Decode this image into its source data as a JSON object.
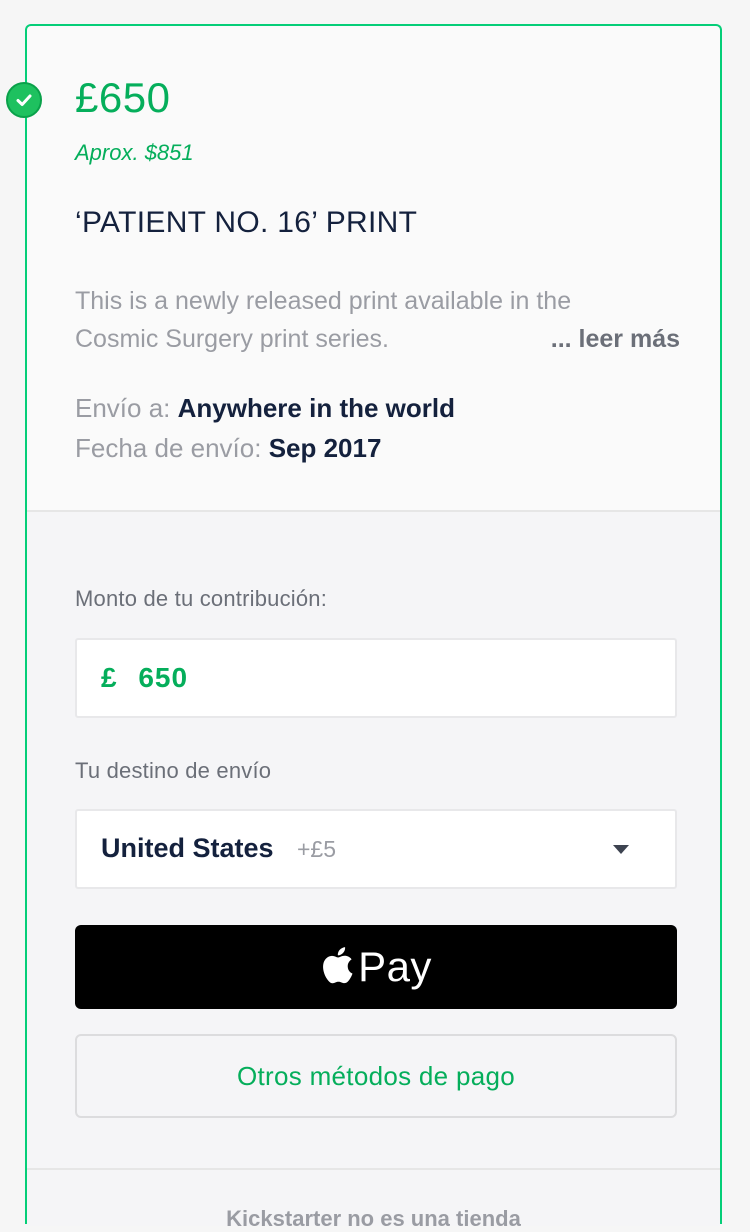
{
  "reward": {
    "price": "£650",
    "approx": "Aprox. $851",
    "title": "‘PATIENT NO. 16’ PRINT",
    "description_line1": "This is a newly released print available in the",
    "description_line2": "Cosmic Surgery print series.",
    "read_more": "... leer más",
    "ships_to_label": "Envío a: ",
    "ships_to_value": "Anywhere in the world",
    "delivery_label": "Fecha de envío: ",
    "delivery_value": "Sep 2017"
  },
  "pledge": {
    "amount_label": "Monto de tu contribución:",
    "currency_symbol": "£",
    "amount_value": "650",
    "destination_label": "Tu destino de envío",
    "destination_value": "United States",
    "destination_extra": "+£5",
    "apple_pay_label": "Pay",
    "other_methods_label": "Otros métodos de pago"
  },
  "footer": {
    "text": "Kickstarter no es una tienda"
  },
  "colors": {
    "accent_green": "#05ae5b",
    "border_green": "#05ce78",
    "dark_text": "#14213d"
  },
  "icons": [
    "check-icon",
    "apple-logo-icon",
    "dropdown-caret-icon"
  ]
}
